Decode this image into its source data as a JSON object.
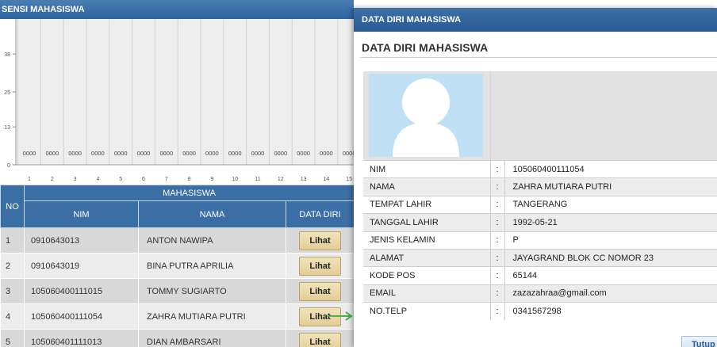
{
  "left_panel": {
    "header_title": "SENSI MAHASISWA"
  },
  "chart_data": {
    "type": "bar",
    "title": "",
    "xlabel": "",
    "ylabel": "",
    "categories": [
      "1",
      "2",
      "3",
      "4",
      "5",
      "6",
      "7",
      "8",
      "9",
      "10",
      "11",
      "12",
      "13",
      "14",
      "15"
    ],
    "values": [
      0,
      0,
      0,
      0,
      0,
      0,
      0,
      0,
      0,
      0,
      0,
      0,
      0,
      0,
      0
    ],
    "data_labels": [
      "0000",
      "0000",
      "0000",
      "0000",
      "0000",
      "0000",
      "0000",
      "0000",
      "0000",
      "0000",
      "0000",
      "0000",
      "0000",
      "0000",
      "0000"
    ],
    "yticks": [
      "38",
      "25",
      "13",
      "0"
    ],
    "ylim": [
      0,
      50
    ],
    "grid": true
  },
  "table": {
    "group_header": "MAHASISWA",
    "columns": {
      "no": "NO",
      "nim": "NIM",
      "nama": "NAMA",
      "data_diri": "DATA DIRI"
    },
    "rows": [
      {
        "no": "1",
        "nim": "0910643013",
        "nama": "ANTON NAWIPA",
        "action": "Lihat"
      },
      {
        "no": "2",
        "nim": "0910643019",
        "nama": "BINA PUTRA APRILIA",
        "action": "Lihat"
      },
      {
        "no": "3",
        "nim": "105060400111015",
        "nama": "TOMMY SUGIARTO",
        "action": "Lihat"
      },
      {
        "no": "4",
        "nim": "105060400111054",
        "nama": "ZAHRA MUTIARA PUTRI",
        "action": "Lihat"
      },
      {
        "no": "5",
        "nim": "105060401111013",
        "nama": "DIAN AMBARSARI",
        "action": "Lihat"
      }
    ]
  },
  "modal": {
    "header_title": "DATA DIRI MAHASISWA",
    "title": "DATA DIRI MAHASISWA",
    "close_label": "Tutup",
    "fields": [
      {
        "label": "NIM",
        "sep": ":",
        "value": "105060400111054"
      },
      {
        "label": "NAMA",
        "sep": ":",
        "value": "ZAHRA MUTIARA PUTRI"
      },
      {
        "label": "TEMPAT LAHIR",
        "sep": ":",
        "value": "TANGERANG"
      },
      {
        "label": "TANGGAL LAHIR",
        "sep": ":",
        "value": "1992-05-21"
      },
      {
        "label": "JENIS KELAMIN",
        "sep": ":",
        "value": "P"
      },
      {
        "label": "ALAMAT",
        "sep": ":",
        "value": "JAYAGRAND BLOK CC NOMOR 23"
      },
      {
        "label": "KODE POS",
        "sep": ":",
        "value": "65144"
      },
      {
        "label": "EMAIL",
        "sep": ":",
        "value": "zazazahraa@gmail.com"
      },
      {
        "label": "NO.TELP",
        "sep": ":",
        "value": "0341567298"
      }
    ]
  },
  "colors": {
    "header_blue": "#2f63a0",
    "button_tan": "#e2ce94",
    "photo_bg": "#bfe0f5",
    "arrow_green": "#4caf50"
  }
}
